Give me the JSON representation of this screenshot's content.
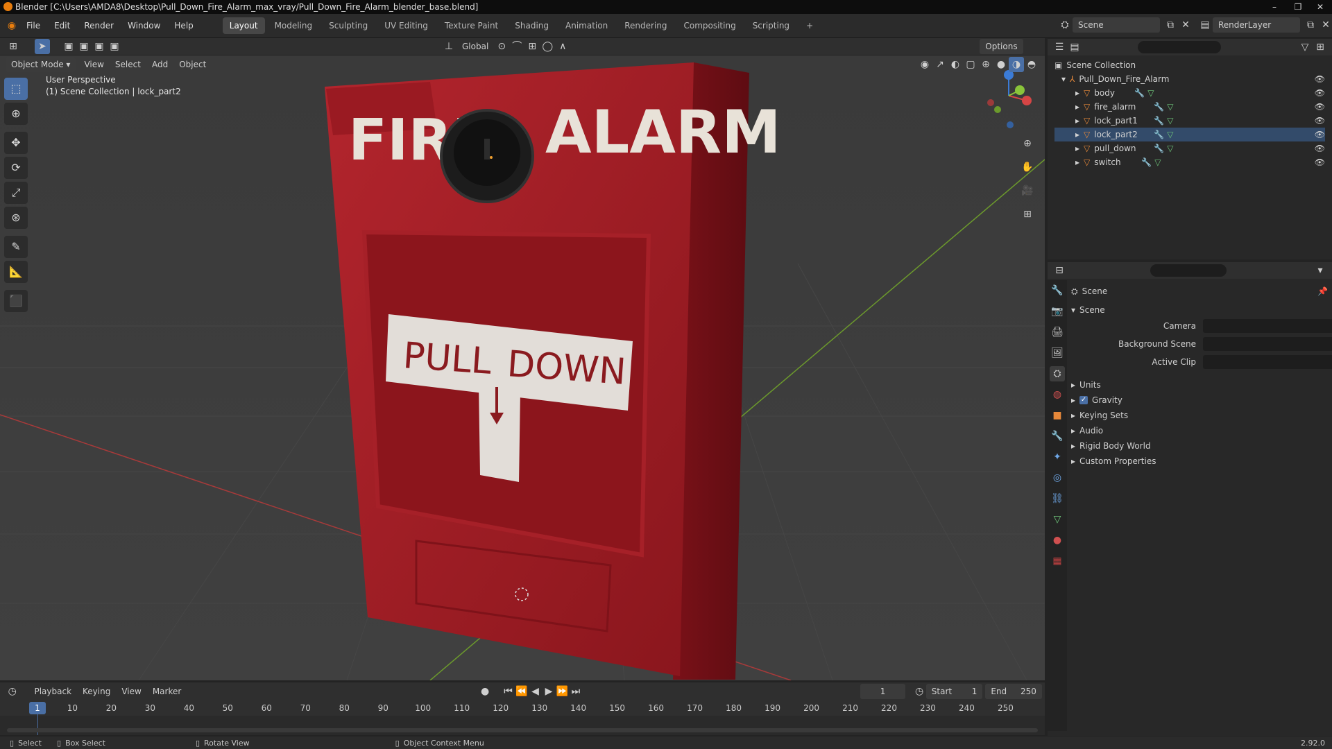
{
  "window": {
    "title": "Blender [C:\\Users\\AMDA8\\Desktop\\Pull_Down_Fire_Alarm_max_vray/Pull_Down_Fire_Alarm_blender_base.blend]"
  },
  "menu": [
    "File",
    "Edit",
    "Render",
    "Window",
    "Help"
  ],
  "workspaces": [
    "Layout",
    "Modeling",
    "Sculpting",
    "UV Editing",
    "Texture Paint",
    "Shading",
    "Animation",
    "Rendering",
    "Compositing",
    "Scripting"
  ],
  "scene": {
    "name": "Scene",
    "render_layer": "RenderLayer"
  },
  "viewport_header": {
    "mode": "Object Mode",
    "view": "View",
    "select": "Select",
    "add": "Add",
    "object": "Object",
    "orientation": "Global",
    "options": "Options"
  },
  "viewport": {
    "perspective": "User Perspective",
    "context": "(1) Scene Collection | lock_part2"
  },
  "model_text": {
    "fire": "FIRE",
    "alarm": "ALARM",
    "pull": "PULL",
    "down": "DOWN"
  },
  "outliner": {
    "root": "Scene Collection",
    "collection": "Pull_Down_Fire_Alarm",
    "items": [
      "body",
      "fire_alarm",
      "lock_part1",
      "lock_part2",
      "pull_down",
      "switch"
    ]
  },
  "properties": {
    "header": "Scene",
    "panel": "Scene",
    "fields": [
      {
        "label": "Camera"
      },
      {
        "label": "Background Scene"
      },
      {
        "label": "Active Clip"
      }
    ],
    "sections": [
      "Units",
      "Gravity",
      "Keying Sets",
      "Audio",
      "Rigid Body World",
      "Custom Properties"
    ]
  },
  "timeline": {
    "menus": [
      "Playback",
      "Keying",
      "View",
      "Marker"
    ],
    "current_frame": "1",
    "start_label": "Start",
    "start": "1",
    "end_label": "End",
    "end": "250",
    "ticks": [
      "1",
      "10",
      "20",
      "30",
      "40",
      "50",
      "60",
      "70",
      "80",
      "90",
      "100",
      "110",
      "120",
      "130",
      "140",
      "150",
      "160",
      "170",
      "180",
      "190",
      "200",
      "210",
      "220",
      "230",
      "240",
      "250"
    ]
  },
  "status": {
    "select": "Select",
    "box_select": "Box Select",
    "rotate": "Rotate View",
    "context_menu": "Object Context Menu",
    "version": "2.92.0"
  },
  "colors": {
    "accent": "#4a6fa5",
    "alarm_red": "#a01d24",
    "object_orange": "#e6883a",
    "modifier_blue": "#6fa8e8",
    "mesh_green": "#6ec47a"
  }
}
